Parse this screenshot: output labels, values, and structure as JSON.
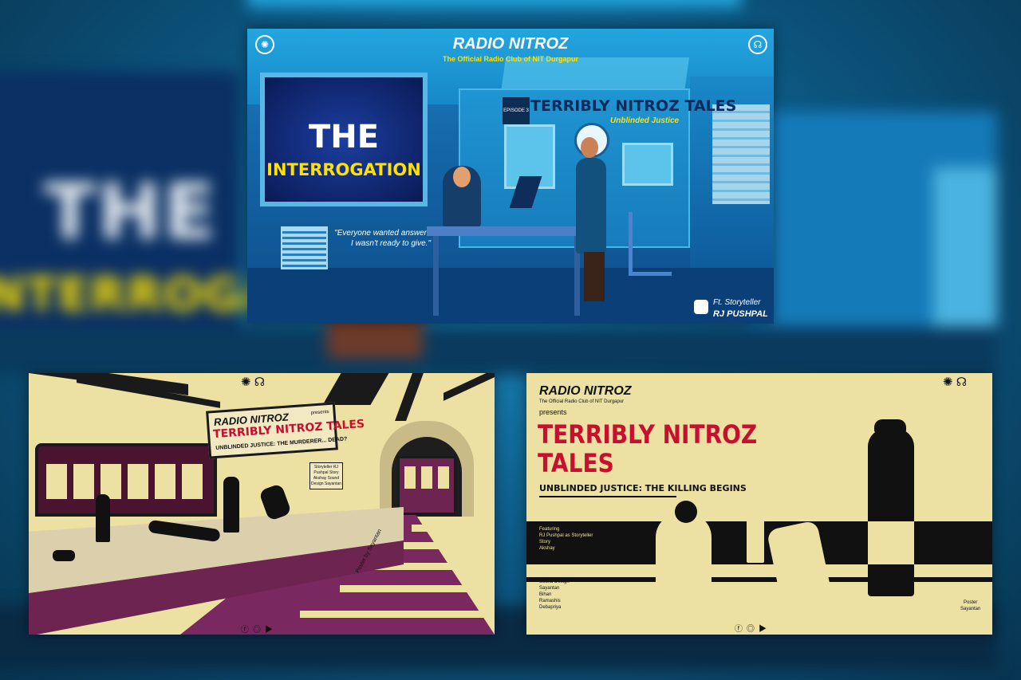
{
  "collage": {
    "background": {
      "blur_the": "THE",
      "blur_interrogation": "INTERROGATION"
    },
    "poster1": {
      "brand": "RADIO NITROZ",
      "brand_sub": "The Official Radio Club of NIT Durgapur",
      "screen_line1": "THE",
      "screen_line2": "INTERROGATION",
      "episode": "EPISODE 3",
      "series_title": "TERRIBLY NITROZ TALES",
      "series_subtitle": "Unblinded Justice",
      "quote": "\"Everyone wanted answers I wasn't ready to give.\"",
      "ft_label": "Ft. Storyteller",
      "storyteller": "RJ PUSHPAL"
    },
    "poster2": {
      "brand": "RADIO NITROZ",
      "presents": "presents",
      "title": "TERRIBLY NITROZ TALES",
      "subtitle": "UNBLINDED JUSTICE: THE MURDERER... DEAD?",
      "credits": "Storyteller RJ Pushpal Story Akshay Sound Design Sayantan",
      "poster_by": "Poster by Sayantan"
    },
    "poster3": {
      "brand": "RADIO NITROZ",
      "brand_sub": "The Official Radio Club of NIT Durgapur",
      "presents": "presents",
      "title_line1": "TERRIBLY NITROZ",
      "title_line2": "TALES",
      "subtitle": "UNBLINDED JUSTICE: THE KILLING BEGINS",
      "featuring_label": "Featuring",
      "featuring_name": "RJ Pushpal as Storyteller",
      "story_label": "Story",
      "story_name": "Akshay",
      "sound_label": "Sound Design",
      "sound_1": "Sayantan",
      "sound_2": "Bihan",
      "sound_3": "Ramashis",
      "sound_4": "Debapriya",
      "poster_label": "Poster",
      "poster_name": "Sayantan"
    },
    "icons": {
      "logo": "institute-logo-icon",
      "headphones": "headphones-icon",
      "facebook": "facebook-icon",
      "instagram": "instagram-icon",
      "youtube": "youtube-icon"
    },
    "colors": {
      "blue_bg": "#0d5a86",
      "cream": "#ece0a2",
      "red_title": "#c8102e",
      "yellow": "#ffe000",
      "maroon": "#6e2450"
    }
  }
}
